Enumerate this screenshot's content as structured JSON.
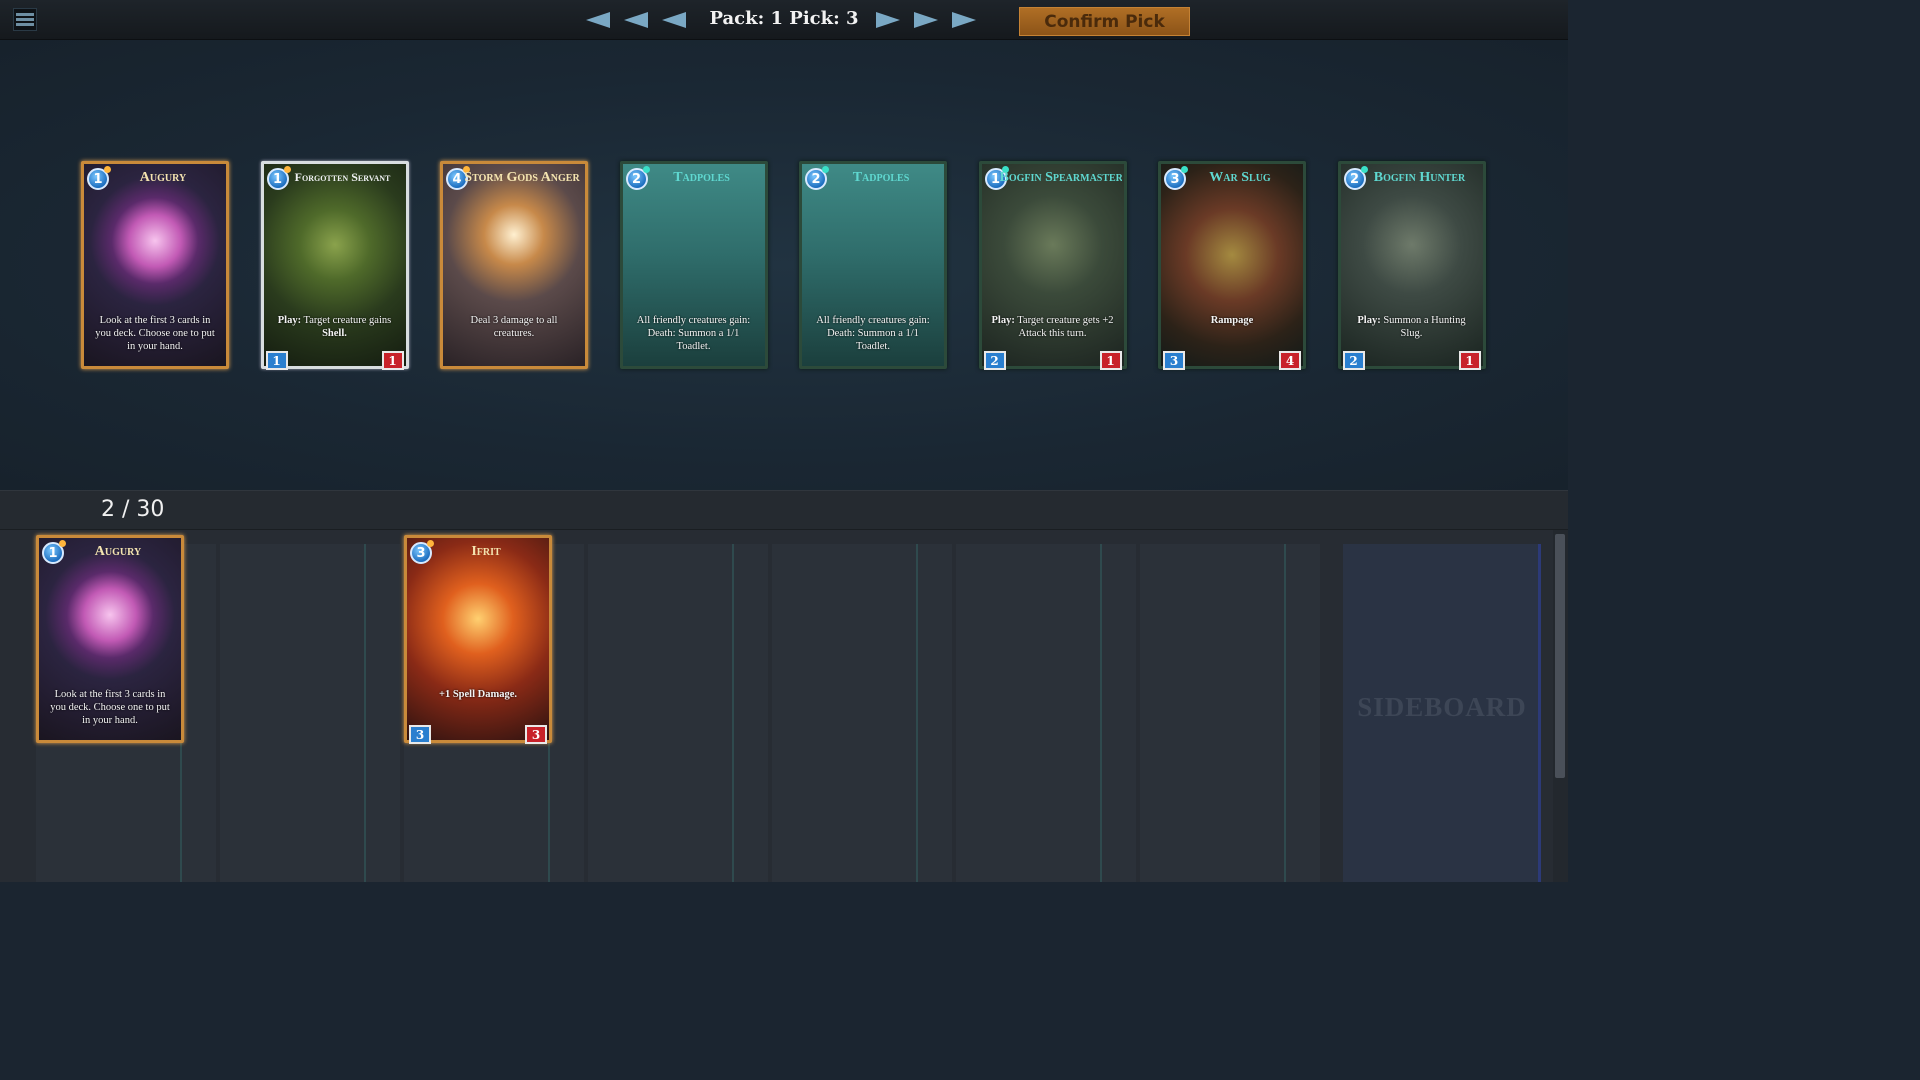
{
  "topbar": {
    "pack_pick_label": "Pack: 1 Pick: 3",
    "confirm_label": "Confirm Pick"
  },
  "pack": [
    {
      "name": "Augury",
      "cost": "1",
      "text": "Look at the first 3 cards in you deck. Choose one to put in your hand.",
      "bold": "",
      "style": "gold",
      "art": "crystal-orb"
    },
    {
      "name": "Forgotten Servant",
      "cost": "1",
      "text": " Target creature gains ",
      "bold": "Play:",
      "bold2": "Shell.",
      "atk": "1",
      "hp": "1",
      "style": "silver",
      "art": "moss-robot"
    },
    {
      "name": "Storm Gods Anger",
      "cost": "4",
      "text": "Deal 3 damage to all creatures.",
      "bold": "",
      "style": "gold",
      "art": "lightning-god"
    },
    {
      "name": "Tadpoles",
      "cost": "2",
      "text": "All friendly creatures gain: Death: Summon a 1/1 Toadlet.",
      "bold": "",
      "style": "swamp",
      "art": "tadpoles"
    },
    {
      "name": "Tadpoles",
      "cost": "2",
      "text": "All friendly creatures gain: Death: Summon a 1/1 Toadlet.",
      "bold": "",
      "style": "swamp",
      "art": "tadpoles"
    },
    {
      "name": "Bogfin Spearmaster",
      "cost": "1",
      "text": " Target creature gets +2 Attack this turn.",
      "bold": "Play:",
      "atk": "2",
      "hp": "1",
      "style": "swamp",
      "art": "frog-warrior"
    },
    {
      "name": "War Slug",
      "cost": "3",
      "text": "",
      "bold": "Rampage",
      "atk": "3",
      "hp": "4",
      "style": "swamp",
      "art": "slug"
    },
    {
      "name": "Bogfin Hunter",
      "cost": "2",
      "text": " Summon a Hunting Slug.",
      "bold": "Play:",
      "atk": "2",
      "hp": "1",
      "style": "swamp",
      "art": "frog-rider"
    }
  ],
  "deck": {
    "count_label": "2 / 30",
    "sideboard_label": "SIDEBOARD",
    "cards": [
      {
        "name": "Augury",
        "cost": "1",
        "text": "Look at the first 3 cards in you deck. Choose one to put in your hand.",
        "bold": "",
        "style": "gold",
        "art": "crystal-orb"
      },
      {
        "name": "Ifrit",
        "cost": "3",
        "text": "",
        "bold": "+1 Spell Damage.",
        "atk": "3",
        "hp": "3",
        "style": "gold",
        "art": "fire-demon"
      }
    ]
  },
  "colors": {
    "accent": "#b06f25",
    "mana": "#1e6fc0",
    "attack": "#2a7fcf",
    "health": "#c8222a"
  }
}
